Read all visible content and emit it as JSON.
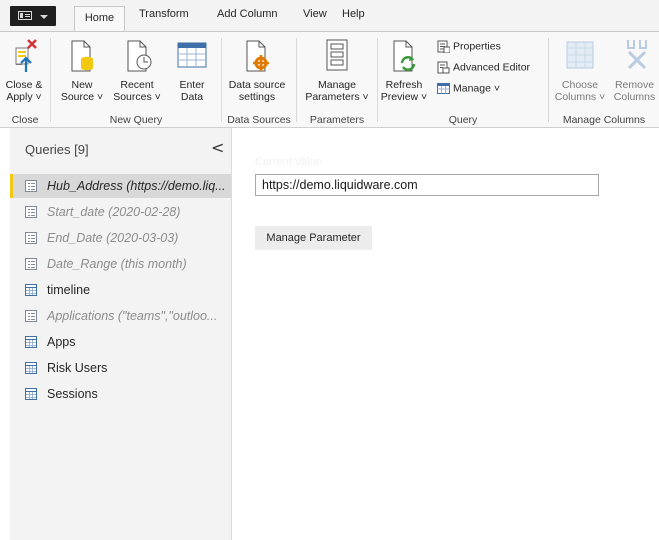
{
  "tabs": {
    "file_menu_icon": "menu-icon",
    "items": [
      "Home",
      "Transform",
      "Add Column",
      "View",
      "Help"
    ],
    "active": "Home"
  },
  "ribbon": {
    "close_apply": {
      "line1": "Close &",
      "line2": "Apply ˅"
    },
    "new_source": {
      "line1": "New",
      "line2": "Source ˅"
    },
    "recent_sources": {
      "line1": "Recent",
      "line2": "Sources ˅"
    },
    "enter_data": {
      "line1": "Enter",
      "line2": "Data"
    },
    "data_source_settings": {
      "line1": "Data source",
      "line2": "settings"
    },
    "manage_parameters": {
      "line1": "Manage",
      "line2": "Parameters ˅"
    },
    "refresh_preview": {
      "line1": "Refresh",
      "line2": "Preview ˅"
    },
    "properties": "Properties",
    "advanced_editor": "Advanced Editor",
    "manage": "Manage ˅",
    "choose_columns": {
      "line1": "Choose",
      "line2": "Columns ˅"
    },
    "remove_columns": {
      "line1": "Remove",
      "line2": "Columns"
    },
    "groups": {
      "close": "Close",
      "new_query": "New Query",
      "data_sources": "Data Sources",
      "parameters": "Parameters",
      "query": "Query",
      "manage_columns": "Manage Columns"
    }
  },
  "queries": {
    "title": "Queries [9]",
    "collapse_glyph": "<",
    "items": [
      {
        "label": "Hub_Address (https://demo.liq...",
        "type": "parameter",
        "selected": true
      },
      {
        "label": "Start_date (2020-02-28)",
        "type": "parameter"
      },
      {
        "label": "End_Date (2020-03-03)",
        "type": "parameter"
      },
      {
        "label": "Date_Range (this month)",
        "type": "parameter"
      },
      {
        "label": "timeline",
        "type": "table"
      },
      {
        "label": "Applications (\"teams\",\"outloo...",
        "type": "parameter"
      },
      {
        "label": "Apps",
        "type": "table"
      },
      {
        "label": "Risk Users",
        "type": "table"
      },
      {
        "label": "Sessions",
        "type": "table"
      }
    ]
  },
  "main": {
    "current_value_label": "Current Value",
    "current_value": "https://demo.liquidware.com",
    "manage_parameter_button": "Manage Parameter"
  },
  "colors": {
    "selection_accent": "#f2c811",
    "close_x": "#d13438",
    "table_icon": "#3e6fa8",
    "refresh_arrow": "#3a9a3a"
  }
}
